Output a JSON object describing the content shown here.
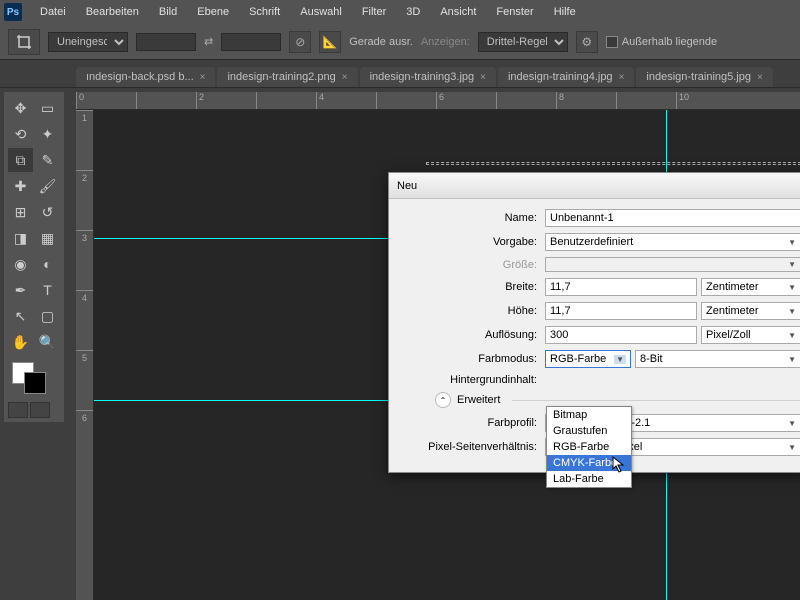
{
  "menu": [
    "Datei",
    "Bearbeiten",
    "Bild",
    "Ebene",
    "Schrift",
    "Auswahl",
    "Filter",
    "3D",
    "Ansicht",
    "Fenster",
    "Hilfe"
  ],
  "options": {
    "aspect": "Uneingeschränkt",
    "straighten": "Gerade ausr.",
    "view_label": "Anzeigen:",
    "view": "Drittel-Regel",
    "outside": "Außerhalb liegende"
  },
  "tabs": [
    "ındesign-back.psd b...",
    "indesign-training2.png",
    "indesign-training3.jpg",
    "indesign-training4.jpg",
    "indesign-training5.jpg"
  ],
  "ruler_h": [
    "0",
    "",
    "2",
    "",
    "4",
    "",
    "6",
    "",
    "8",
    "",
    "10"
  ],
  "ruler_v": [
    "1",
    "",
    "2",
    "",
    "3",
    "",
    "4",
    "",
    "5",
    "",
    "6"
  ],
  "dialog": {
    "title": "Neu",
    "name_label": "Name:",
    "name": "Unbenannt-1",
    "preset_label": "Vorgabe:",
    "preset": "Benutzerdefiniert",
    "size_label": "Größe:",
    "size": "",
    "width_label": "Breite:",
    "width": "11,7",
    "width_unit": "Zentimeter",
    "height_label": "Höhe:",
    "height": "11,7",
    "height_unit": "Zentimeter",
    "res_label": "Auflösung:",
    "res": "300",
    "res_unit": "Pixel/Zoll",
    "mode_label": "Farbmodus:",
    "mode": "RGB-Farbe",
    "depth": "8-Bit",
    "bg_label": "Hintergrundinhalt:",
    "expand_label": "Erweitert",
    "profile_label": "Farbprofil:",
    "profile": "sRGB IEC61966-2.1",
    "pixelratio_label": "Pixel-Seitenverhältnis:",
    "pixelratio": "Quadratische Pixel",
    "mode_options": [
      "Bitmap",
      "Graustufen",
      "RGB-Farbe",
      "CMYK-Farbe",
      "Lab-Farbe"
    ],
    "mode_selected_index": 3
  }
}
